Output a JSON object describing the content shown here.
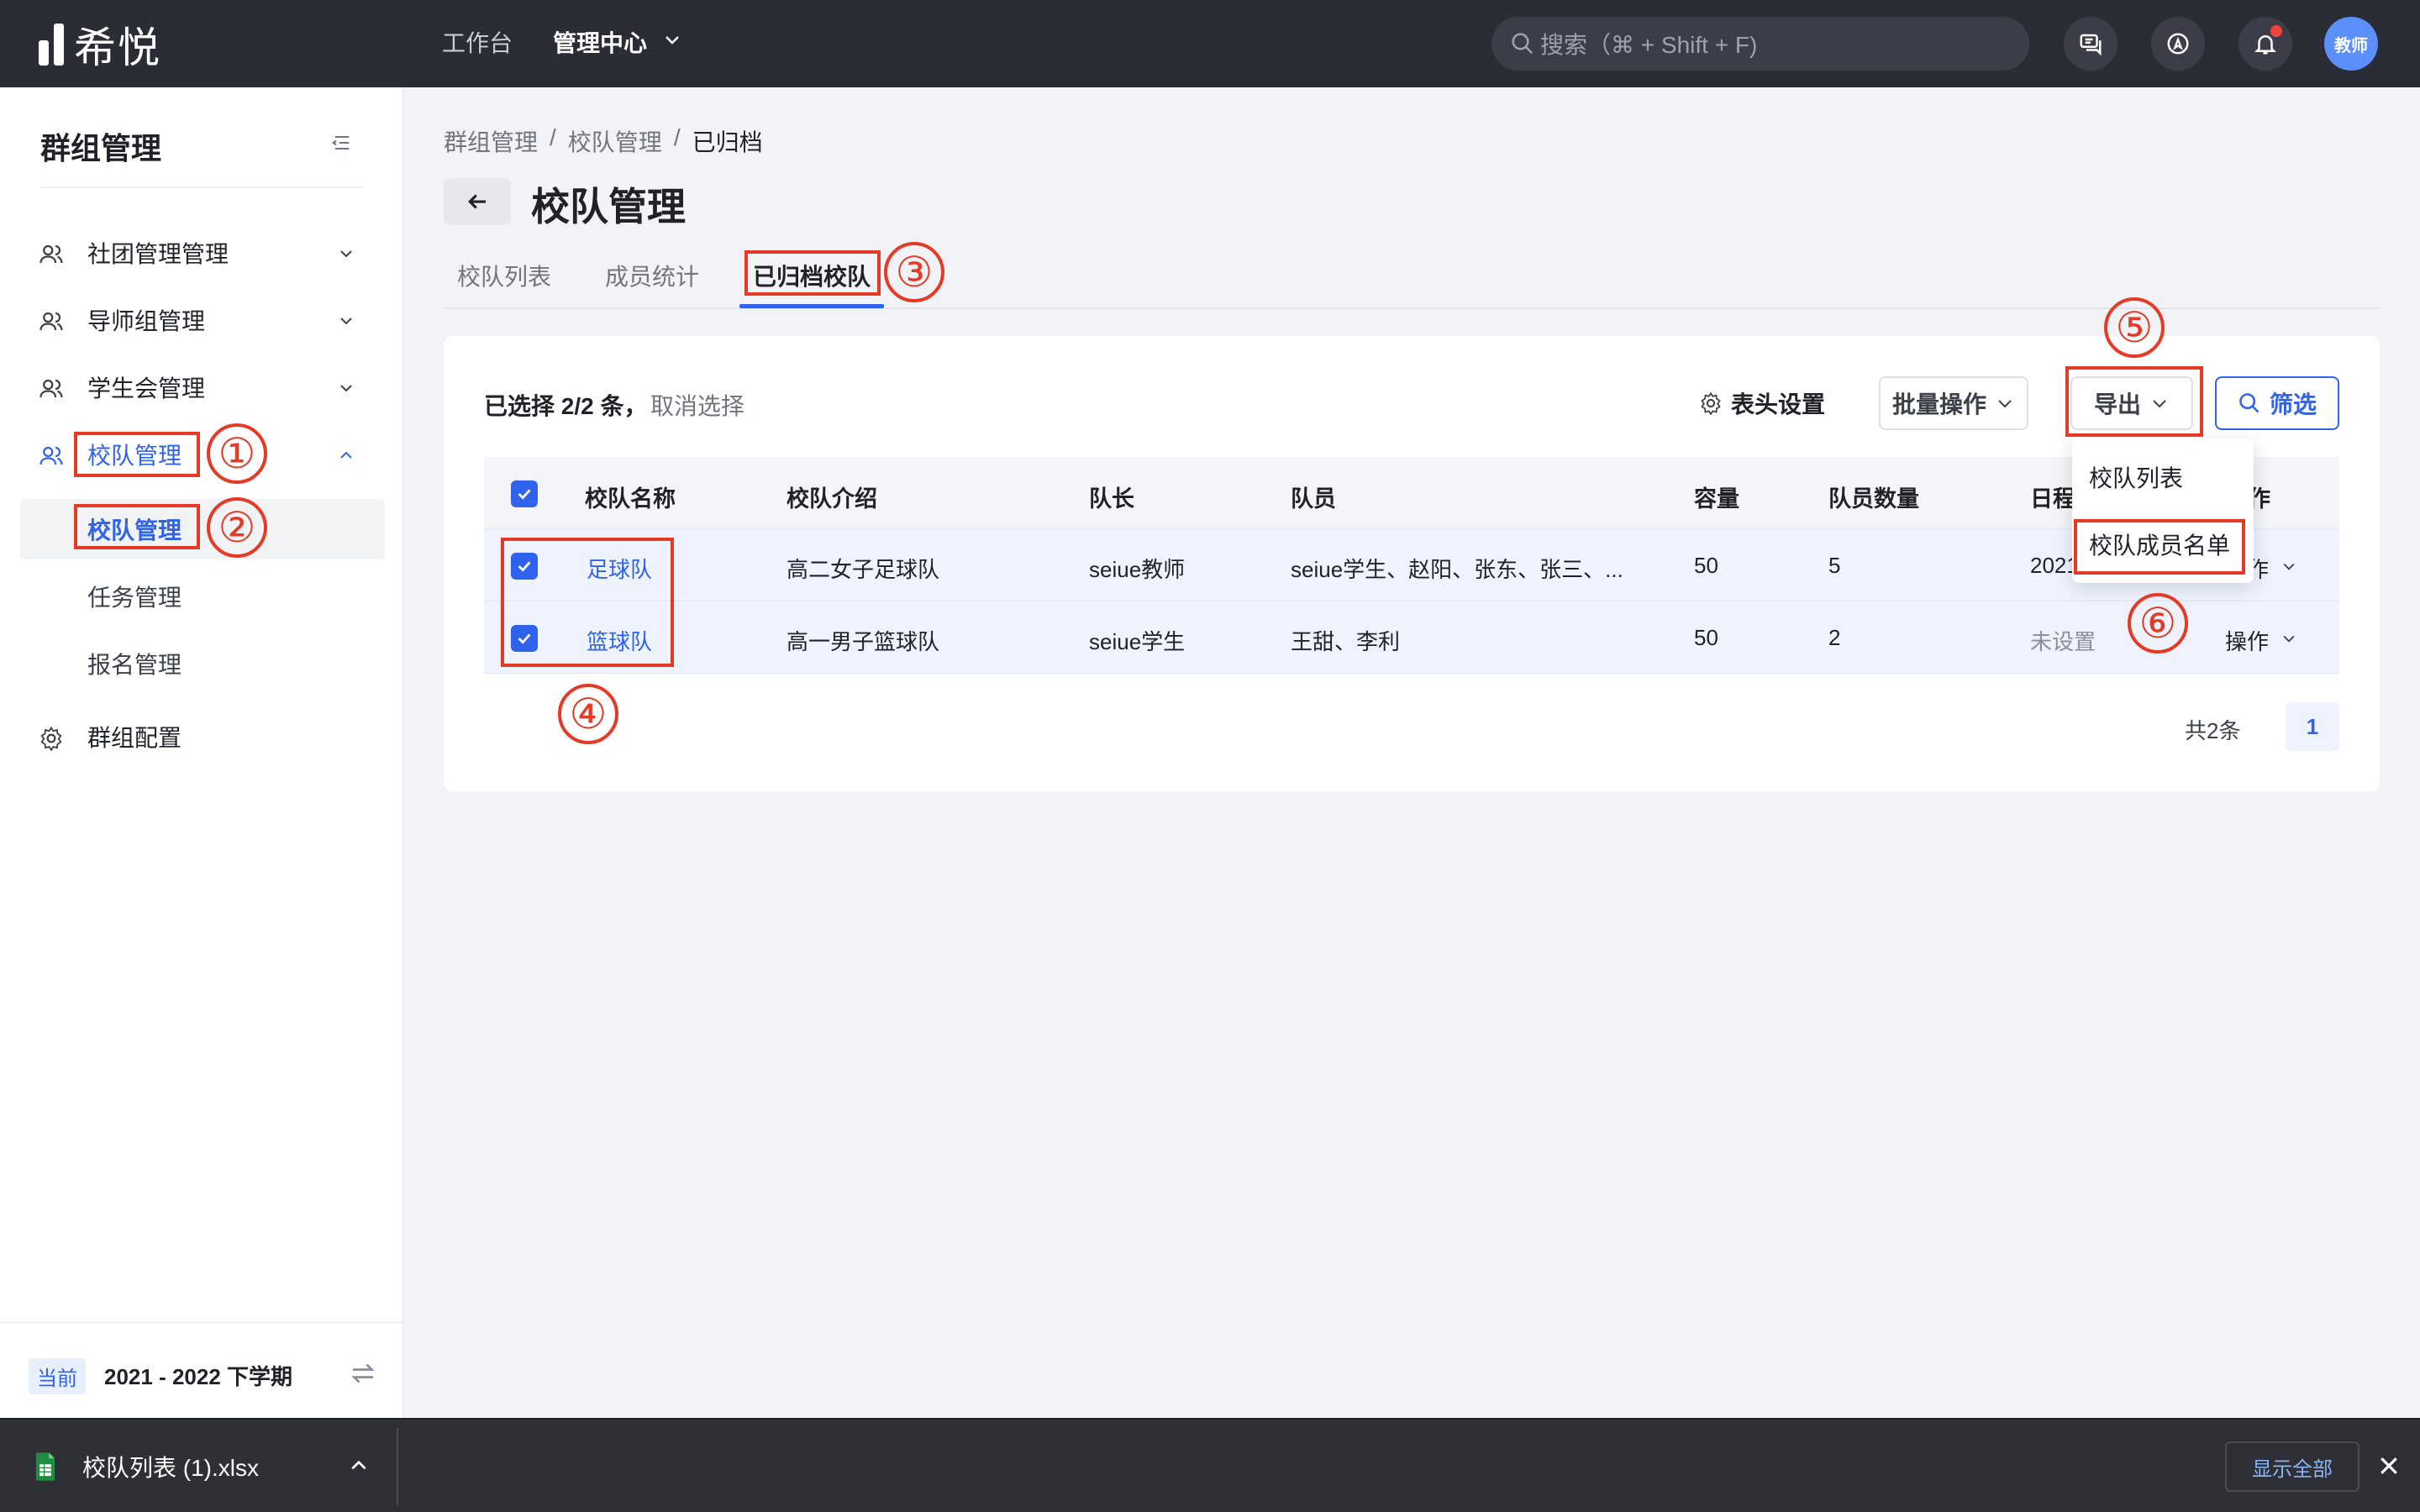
{
  "app": {
    "logo_text": "希悦"
  },
  "topnav": {
    "workbench": "工作台",
    "management_center": "管理中心",
    "search_placeholder": "搜索（⌘ + Shift + F)",
    "avatar_text": "教师"
  },
  "sidebar": {
    "title": "群组管理",
    "items": [
      {
        "label": "社团管理管理",
        "icon": "users-icon",
        "expanded": false
      },
      {
        "label": "导师组管理",
        "icon": "users-icon",
        "expanded": false
      },
      {
        "label": "学生会管理",
        "icon": "users-icon",
        "expanded": false
      },
      {
        "label": "校队管理",
        "icon": "users-icon",
        "expanded": true
      }
    ],
    "sub_items": [
      {
        "label": "校队管理",
        "active": true
      },
      {
        "label": "任务管理",
        "active": false
      },
      {
        "label": "报名管理",
        "active": false
      }
    ],
    "config": {
      "label": "群组配置",
      "icon": "gear-icon"
    },
    "footer": {
      "current_badge": "当前",
      "semester": "2021 - 2022 下学期"
    }
  },
  "breadcrumb": [
    "群组管理",
    "校队管理",
    "已归档"
  ],
  "page": {
    "title": "校队管理",
    "tabs": [
      {
        "label": "校队列表",
        "active": false
      },
      {
        "label": "成员统计",
        "active": false
      },
      {
        "label": "已归档校队",
        "active": true
      }
    ]
  },
  "toolbar": {
    "selected_text": "已选择 2/2 条，",
    "cancel_selection": "取消选择",
    "header_settings": "表头设置",
    "batch_ops": "批量操作",
    "export": "导出",
    "filter": "筛选"
  },
  "export_menu": [
    "校队列表",
    "校队成员名单"
  ],
  "table": {
    "columns": [
      "校队名称",
      "校队介绍",
      "队长",
      "队员",
      "容量",
      "队员数量",
      "日程",
      "操作"
    ],
    "rows": [
      {
        "checked": true,
        "name": "足球队",
        "intro": "高二女子足球队",
        "captain": "seiue教师",
        "members": "seiue学生、赵阳、张东、张三、...",
        "capacity": "50",
        "member_count": "5",
        "schedule": "2021",
        "action": "操作"
      },
      {
        "checked": true,
        "name": "篮球队",
        "intro": "高一男子篮球队",
        "captain": "seiue学生",
        "members": "王甜、李利",
        "capacity": "50",
        "member_count": "2",
        "schedule": "未设置",
        "action": "操作"
      }
    ]
  },
  "pagination": {
    "total": "共2条",
    "current": "1"
  },
  "annotations": [
    "①",
    "②",
    "③",
    "④",
    "⑤",
    "⑥"
  ],
  "download_bar": {
    "file": "校队列表 (1).xlsx",
    "show_all": "显示全部"
  },
  "colors": {
    "accent": "#3063ed",
    "annotation": "#e53a25",
    "topbar": "#2b2d36"
  }
}
